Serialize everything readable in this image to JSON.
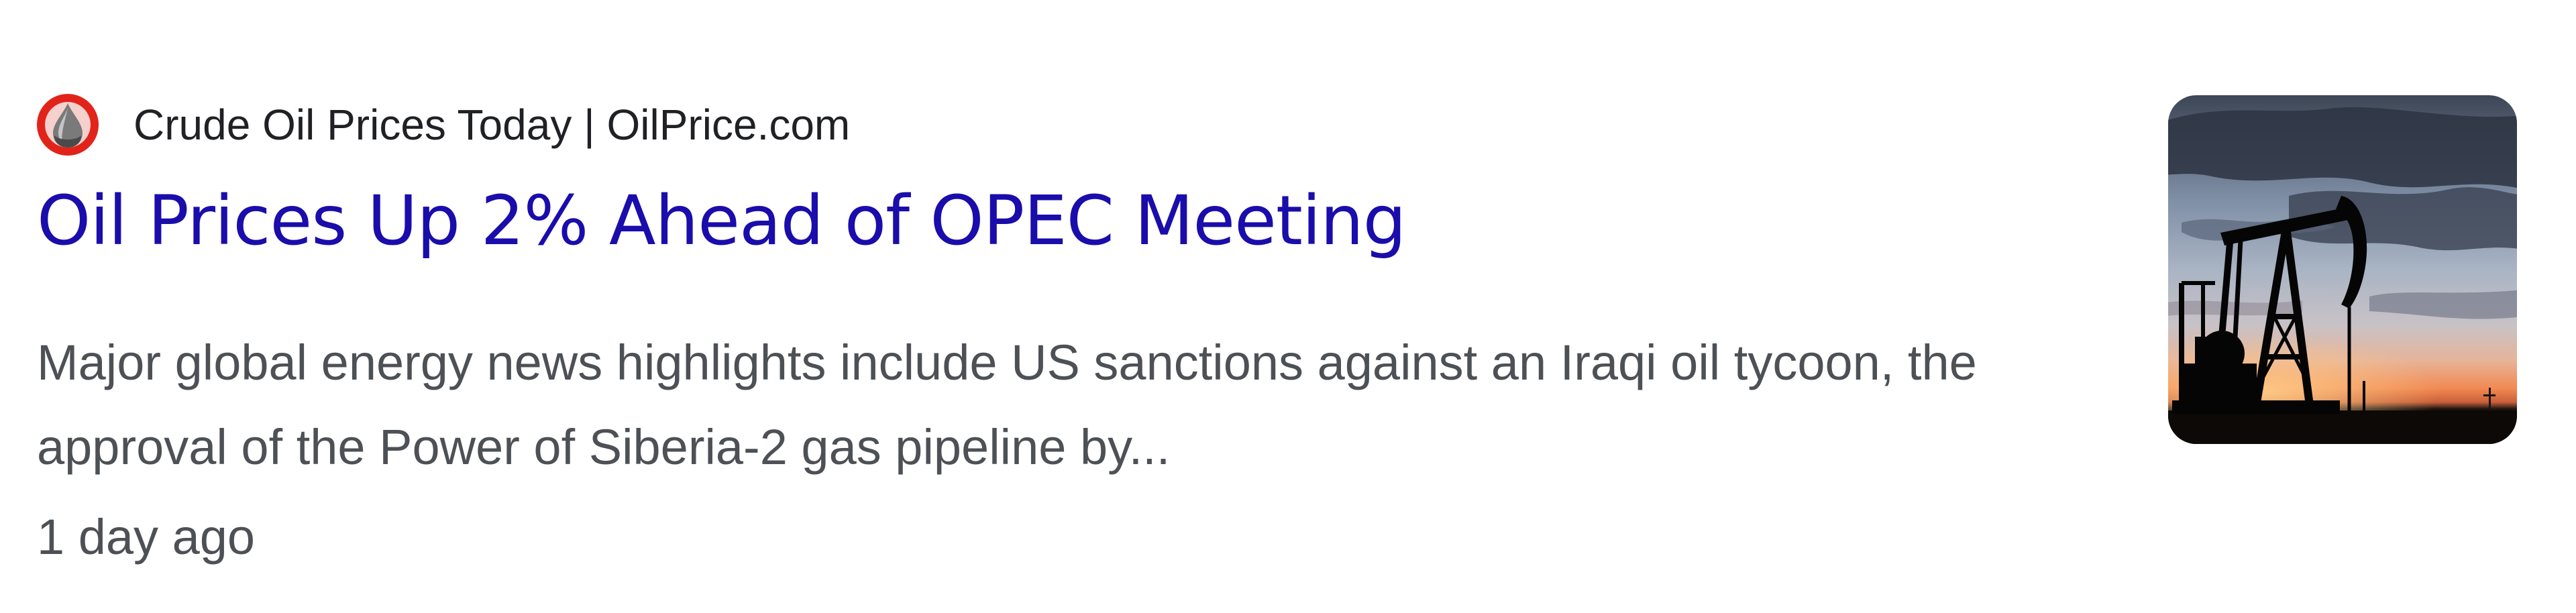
{
  "result": {
    "source": {
      "name": "Crude Oil Prices Today | OilPrice.com",
      "favicon_icon": "oil-drop-icon",
      "favicon_color": "#e2231a"
    },
    "title": "Oil Prices Up 2% Ahead of OPEC Meeting",
    "snippet": "Major global energy news highlights include US sanctions against an Iraqi oil tycoon, the approval of the Power of Siberia-2 gas pipeline by...",
    "age": "1 day ago",
    "thumbnail_icon": "oil-pumpjack-sunset-image"
  },
  "colors": {
    "link": "#1a0dab",
    "source_text": "#202124",
    "body_text": "#4d5156"
  }
}
